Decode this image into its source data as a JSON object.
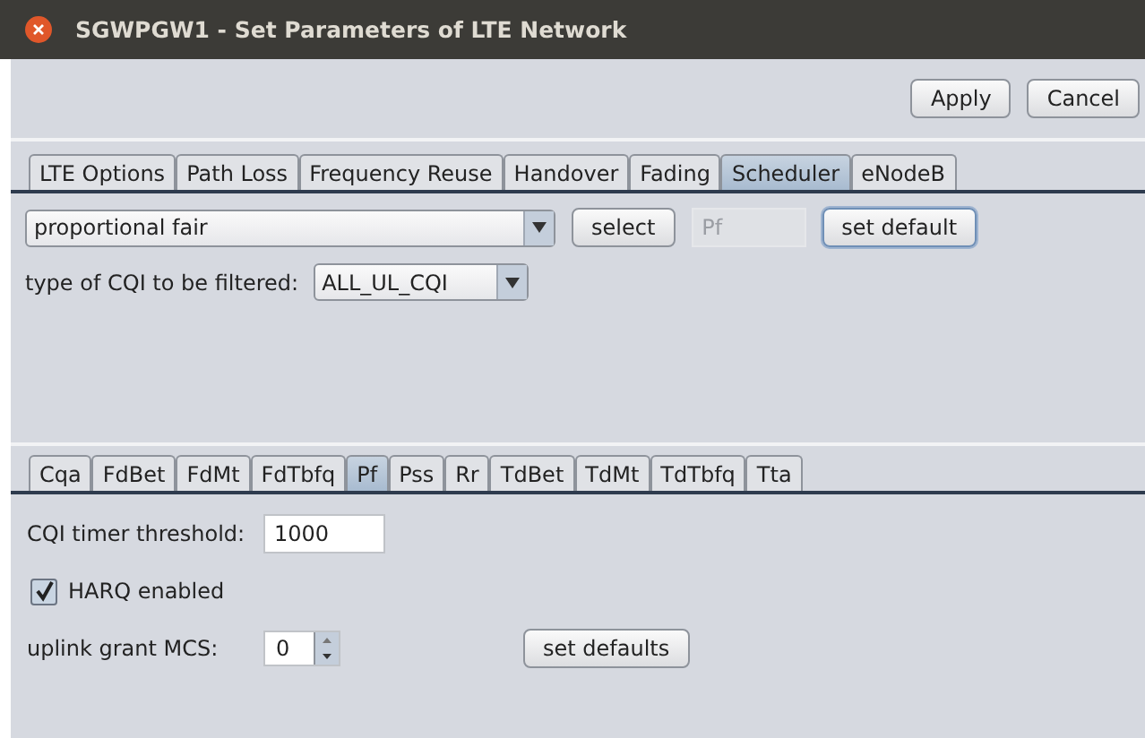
{
  "window": {
    "title": "SGWPGW1 - Set Parameters of LTE Network"
  },
  "buttons": [
    "Apply",
    "Cancel"
  ],
  "tabs": [
    {
      "label": "LTE Options",
      "selected": false
    },
    {
      "label": "Path Loss",
      "selected": false
    },
    {
      "label": "Frequency Reuse",
      "selected": false
    },
    {
      "label": "Handover",
      "selected": false
    },
    {
      "label": "Fading",
      "selected": false
    },
    {
      "label": "Scheduler",
      "selected": true
    },
    {
      "label": "eNodeB",
      "selected": false
    }
  ],
  "scheduler": {
    "dropdown": "proportional fair",
    "select_button": "select",
    "name_field": {
      "value": "Pf",
      "disabled": true
    },
    "default_button": "set default",
    "cqi_label": "type of CQI to be filtered:",
    "cqi_dropdown": "ALL_UL_CQI"
  },
  "subtabs": [
    {
      "label": "Cqa",
      "selected": false
    },
    {
      "label": "FdBet",
      "selected": false
    },
    {
      "label": "FdMt",
      "selected": false
    },
    {
      "label": "FdTbfq",
      "selected": false
    },
    {
      "label": "Pf",
      "selected": true
    },
    {
      "label": "Pss",
      "selected": false
    },
    {
      "label": "Rr",
      "selected": false
    },
    {
      "label": "TdBet",
      "selected": false
    },
    {
      "label": "TdMt",
      "selected": false
    },
    {
      "label": "TdTbfq",
      "selected": false
    },
    {
      "label": "Tta",
      "selected": false
    }
  ],
  "pf": {
    "threshold_label": "CQI timer threshold:",
    "threshold_value": "1000",
    "harq": {
      "label": "HARQ enabled",
      "checked": true
    },
    "mcs_label": "uplink grant MCS:",
    "mcs_value": "0",
    "defaults_button": "set defaults"
  }
}
